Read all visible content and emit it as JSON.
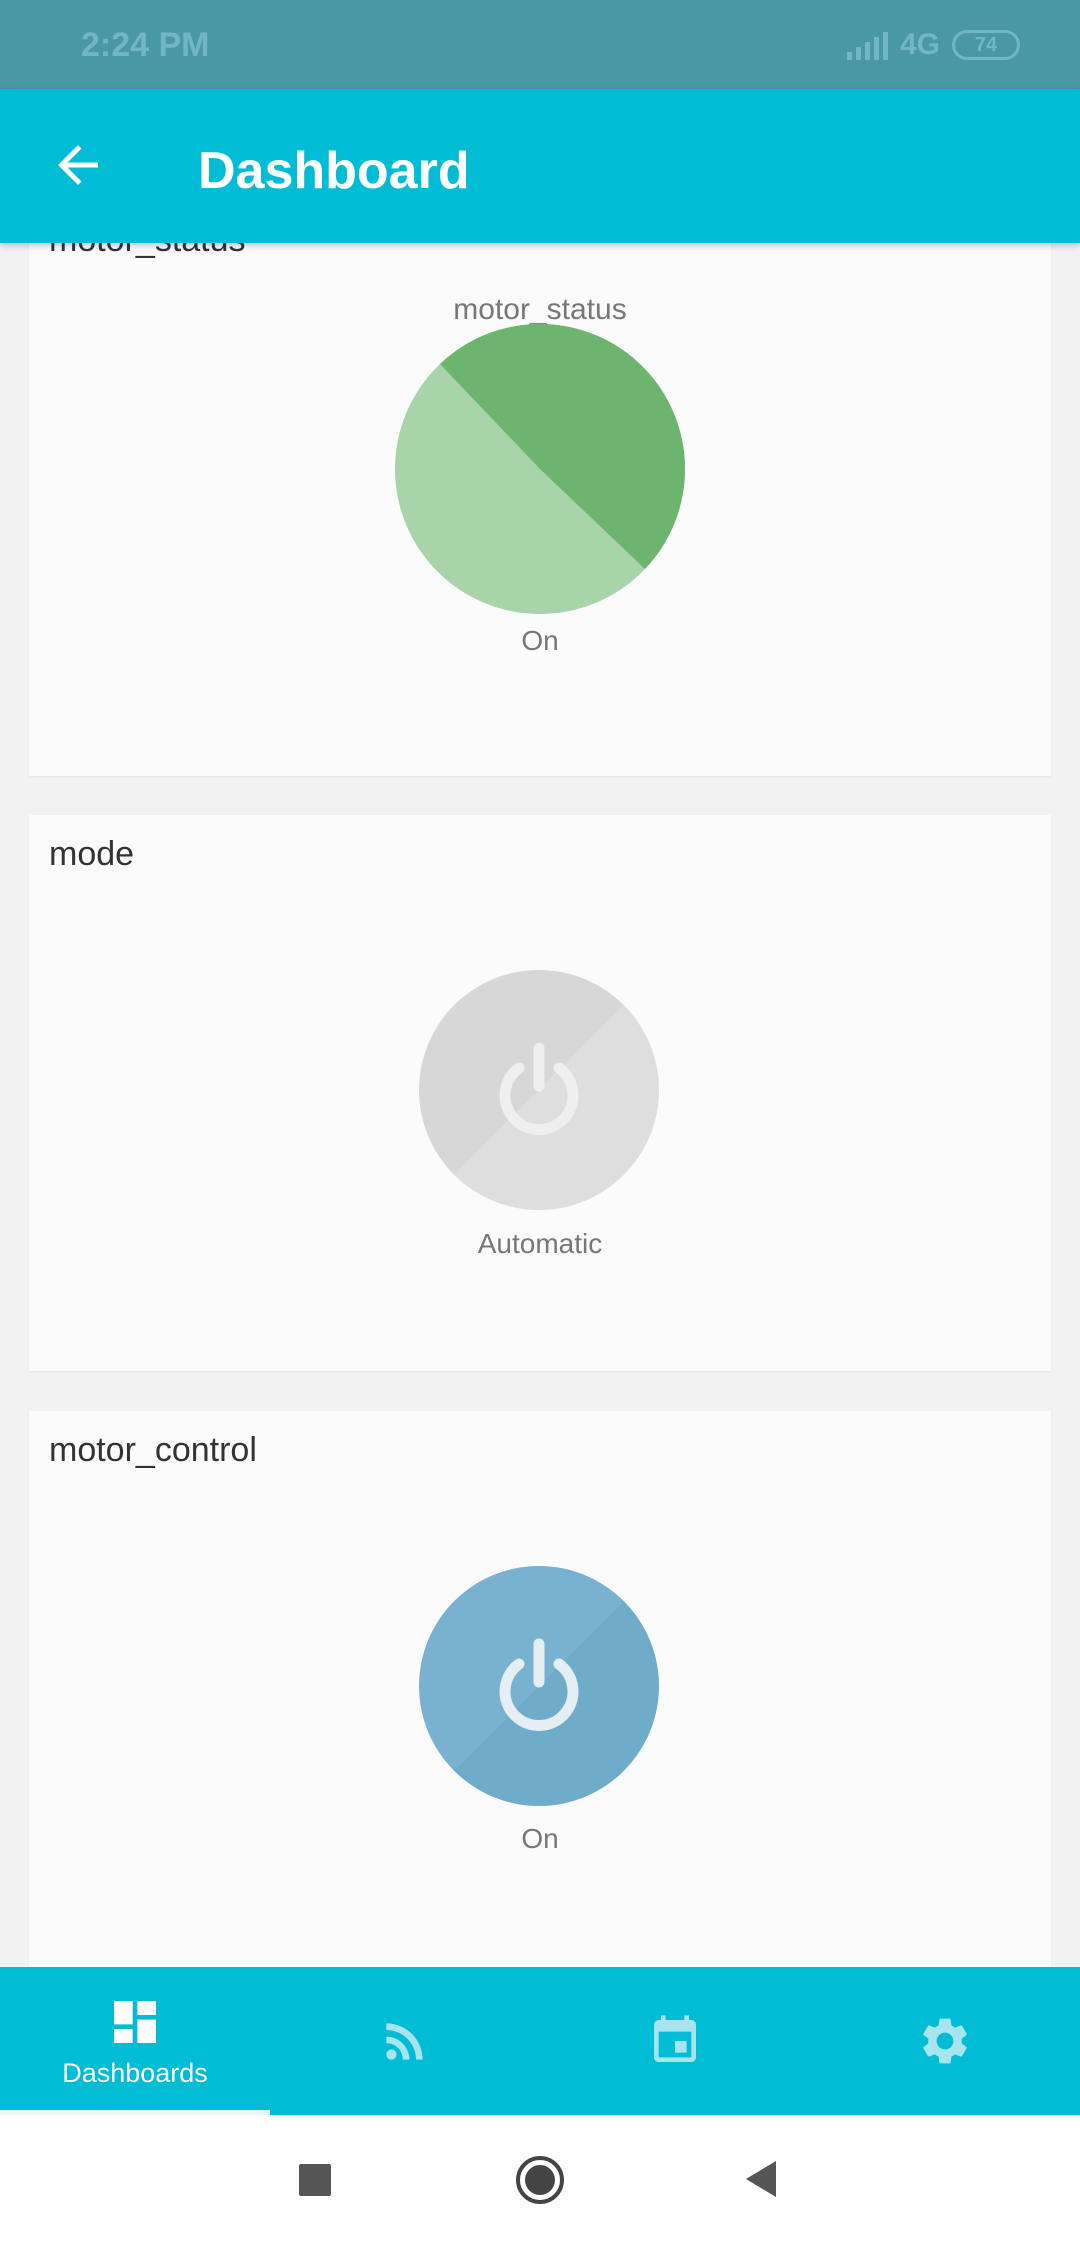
{
  "status_bar": {
    "time": "2:24 PM",
    "network": "4G",
    "battery": "74"
  },
  "app_bar": {
    "title": "Dashboard",
    "back_icon": "arrow-back-icon"
  },
  "cards": [
    {
      "title": "motor_status",
      "gauge_name": "motor_status",
      "value": "On",
      "pie": {
        "slices": [
          {
            "label": "On",
            "fraction": 0.5,
            "color": "#a8d4a9"
          },
          {
            "label": "",
            "fraction": 0.5,
            "color": "#6db56f"
          }
        ]
      }
    },
    {
      "title": "mode",
      "value": "Automatic",
      "button_color": "#d8d8d8",
      "icon": "power-icon"
    },
    {
      "title": "motor_control",
      "value": "On",
      "button_color": "#74afcd",
      "icon": "power-icon"
    }
  ],
  "bottom_nav": {
    "items": [
      {
        "label": "Dashboards",
        "icon": "dashboard-icon",
        "active": true
      },
      {
        "label": "",
        "icon": "rss-feed-icon",
        "active": false
      },
      {
        "label": "",
        "icon": "calendar-icon",
        "active": false
      },
      {
        "label": "",
        "icon": "gear-icon",
        "active": false
      }
    ]
  },
  "system_nav": {
    "icons": [
      "recents-square-icon",
      "home-circle-icon",
      "back-triangle-icon"
    ]
  },
  "colors": {
    "primary": "#00bcd4",
    "status_bar": "#4a97a5",
    "pie_light": "#a8d4a9",
    "pie_dark": "#6db56f",
    "button_blue": "#74afcd",
    "button_gray": "#d8d8d8"
  }
}
